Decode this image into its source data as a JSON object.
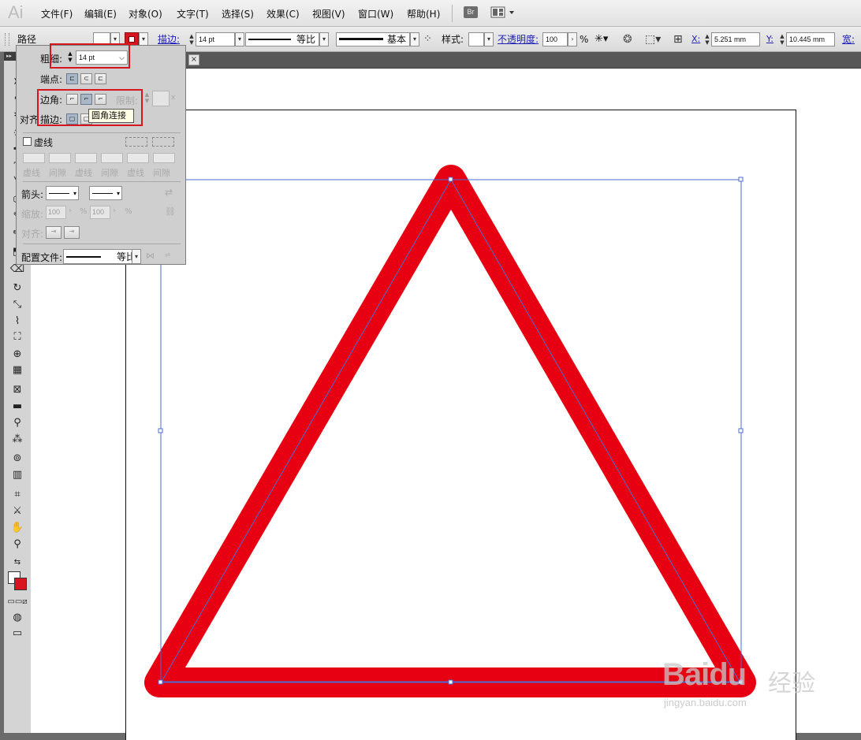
{
  "app": {
    "logo": "Ai"
  },
  "menu": {
    "items": [
      "文件(F)",
      "编辑(E)",
      "对象(O)",
      "文字(T)",
      "选择(S)",
      "效果(C)",
      "视图(V)",
      "窗口(W)",
      "帮助(H)"
    ],
    "bridge_label": "Br"
  },
  "options_bar": {
    "selection_type": "路径",
    "stroke_label": "描边:",
    "stroke_weight": "14 pt",
    "profile_label": "等比",
    "brush_label": "基本",
    "style_label": "样式:",
    "opacity_label": "不透明度:",
    "opacity_value": "100",
    "opacity_unit": "%",
    "x_label": "X:",
    "x_value": "5.251 mm",
    "y_label": "Y:",
    "y_value": "10.445 mm",
    "width_label": "宽:",
    "stroke_color": "#d8141e"
  },
  "stroke_panel": {
    "weight_label": "粗细:",
    "weight_value": "14 pt",
    "cap_label": "端点:",
    "corner_label": "边角:",
    "limit_label": "限制:",
    "limit_unit": "x",
    "align_label_a": "对齐",
    "align_label_b": "描边:",
    "dashed_label": "虚线",
    "dash_labels": [
      "虚线",
      "间隙",
      "虚线",
      "间隙",
      "虚线",
      "间隙"
    ],
    "arrow_label": "箭头:",
    "scale_label": "缩放:",
    "scale_value_1": "100",
    "scale_value_2": "100",
    "scale_unit": "%",
    "arrow_align_label": "对齐:",
    "profile_label": "配置文件:",
    "profile_value": "等比"
  },
  "tooltip": {
    "text": "圆角连接"
  },
  "artwork": {
    "stroke_color": "#e60012",
    "path_color": "#4a6cd4"
  },
  "watermark": {
    "logo": "Baidu",
    "cn": "经验",
    "url": "jingyan.baidu.com"
  }
}
